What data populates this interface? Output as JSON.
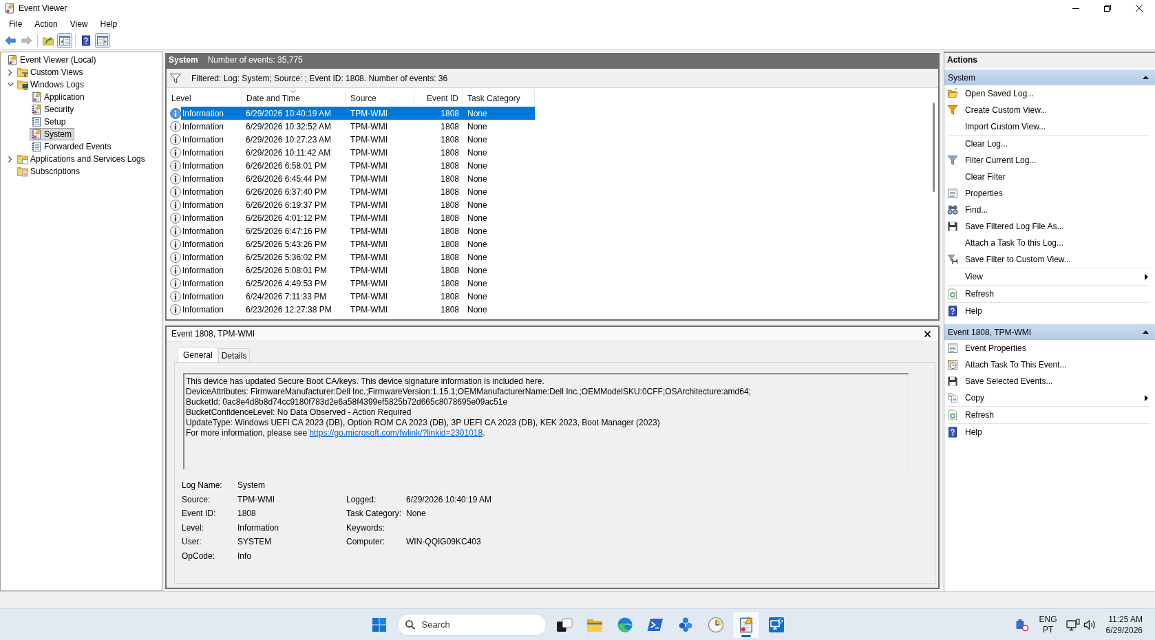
{
  "window": {
    "title": "Event Viewer"
  },
  "menu": [
    {
      "label": "File"
    },
    {
      "label": "Action"
    },
    {
      "label": "View"
    },
    {
      "label": "Help"
    }
  ],
  "toolbar": [
    [
      {
        "kind": "back",
        "disabled": false,
        "on": false
      },
      {
        "kind": "forward",
        "disabled": true,
        "on": false
      }
    ],
    [
      {
        "kind": "up",
        "disabled": false,
        "on": false
      },
      {
        "kind": "treepane",
        "disabled": false,
        "on": true
      }
    ],
    [
      {
        "kind": "help",
        "disabled": false,
        "on": false
      },
      {
        "kind": "actionpane",
        "disabled": false,
        "on": true
      }
    ]
  ],
  "tree": [
    {
      "label": "Event Viewer (Local)",
      "kind": "root",
      "selected": false,
      "children": [
        {
          "label": "Custom Views",
          "kind": "filterfolder",
          "expanded": false,
          "selected": false
        },
        {
          "label": "Windows Logs",
          "kind": "logfolder",
          "expanded": true,
          "selected": false,
          "children": [
            {
              "label": "Application",
              "kind": "alertlog",
              "selected": false
            },
            {
              "label": "Security",
              "kind": "alertlog",
              "selected": false
            },
            {
              "label": "Setup",
              "kind": "log",
              "selected": false
            },
            {
              "label": "System",
              "kind": "alertlog",
              "selected": true
            },
            {
              "label": "Forwarded Events",
              "kind": "log",
              "selected": false
            }
          ]
        },
        {
          "label": "Applications and Services Logs",
          "kind": "appfolder",
          "expanded": false,
          "selected": false
        },
        {
          "label": "Subscriptions",
          "kind": "subfolder",
          "selected": false
        }
      ]
    }
  ],
  "log_header": {
    "title": "System",
    "count": "Number of events: 35,775"
  },
  "filter": {
    "text": "Filtered: Log: System; Source: ; Event ID: 1808. Number of events: 36"
  },
  "table": {
    "columns": [
      {
        "label": "Level",
        "kind": "text",
        "sorted": false
      },
      {
        "label": "Date and Time",
        "kind": "text",
        "sorted": true
      },
      {
        "label": "Source",
        "kind": "text",
        "sorted": false
      },
      {
        "label": "Event ID",
        "kind": "number",
        "sorted": false
      },
      {
        "label": "Task Category",
        "kind": "text",
        "sorted": false
      }
    ],
    "rows": [
      {
        "cells": [
          "Information",
          "6/29/2026 10:40:19 AM",
          "TPM-WMI",
          "1808",
          "None"
        ],
        "selected": true
      },
      {
        "cells": [
          "Information",
          "6/29/2026 10:32:52 AM",
          "TPM-WMI",
          "1808",
          "None"
        ],
        "selected": false
      },
      {
        "cells": [
          "Information",
          "6/29/2026 10:27:23 AM",
          "TPM-WMI",
          "1808",
          "None"
        ],
        "selected": false
      },
      {
        "cells": [
          "Information",
          "6/29/2026 10:11:42 AM",
          "TPM-WMI",
          "1808",
          "None"
        ],
        "selected": false
      },
      {
        "cells": [
          "Information",
          "6/26/2026 6:58:01 PM",
          "TPM-WMI",
          "1808",
          "None"
        ],
        "selected": false
      },
      {
        "cells": [
          "Information",
          "6/26/2026 6:45:44 PM",
          "TPM-WMI",
          "1808",
          "None"
        ],
        "selected": false
      },
      {
        "cells": [
          "Information",
          "6/26/2026 6:37:40 PM",
          "TPM-WMI",
          "1808",
          "None"
        ],
        "selected": false
      },
      {
        "cells": [
          "Information",
          "6/26/2026 6:19:37 PM",
          "TPM-WMI",
          "1808",
          "None"
        ],
        "selected": false
      },
      {
        "cells": [
          "Information",
          "6/26/2026 4:01:12 PM",
          "TPM-WMI",
          "1808",
          "None"
        ],
        "selected": false
      },
      {
        "cells": [
          "Information",
          "6/25/2026 6:47:16 PM",
          "TPM-WMI",
          "1808",
          "None"
        ],
        "selected": false
      },
      {
        "cells": [
          "Information",
          "6/25/2026 5:43:26 PM",
          "TPM-WMI",
          "1808",
          "None"
        ],
        "selected": false
      },
      {
        "cells": [
          "Information",
          "6/25/2026 5:36:02 PM",
          "TPM-WMI",
          "1808",
          "None"
        ],
        "selected": false
      },
      {
        "cells": [
          "Information",
          "6/25/2026 5:08:01 PM",
          "TPM-WMI",
          "1808",
          "None"
        ],
        "selected": false
      },
      {
        "cells": [
          "Information",
          "6/25/2026 4:49:53 PM",
          "TPM-WMI",
          "1808",
          "None"
        ],
        "selected": false
      },
      {
        "cells": [
          "Information",
          "6/24/2026 7:11:33 PM",
          "TPM-WMI",
          "1808",
          "None"
        ],
        "selected": false
      },
      {
        "cells": [
          "Information",
          "6/23/2026 12:27:38 PM",
          "TPM-WMI",
          "1808",
          "None"
        ],
        "selected": false
      }
    ]
  },
  "event": {
    "title": "Event 1808, TPM-WMI",
    "tabs": [
      {
        "label": "General",
        "selected": true
      },
      {
        "label": "Details",
        "selected": false
      }
    ],
    "message": [
      "This device has updated Secure Boot CA/keys. This device signature information is included here.",
      "DeviceAttributes: FirmwareManufacturer:Dell Inc.;FirmwareVersion:1.15.1;OEMManufacturerName:Dell Inc.;OEMModelSKU:0CFF;OSArchitecture:amd64;",
      "BucketId: 0ac8e4d8b8d74cc9180f783d2e6a58f4399ef5825b72d665c8078695e09ac51e",
      "BucketConfidenceLevel: No Data Observed - Action Required",
      "UpdateType: Windows UEFI CA 2023 (DB), Option ROM CA 2023 (DB), 3P UEFI CA 2023 (DB), KEK 2023, Boot Manager (2023)"
    ],
    "more_info": {
      "text": "For more information, please see ",
      "link": "https://go.microsoft.com/fwlink/?linkid=2301018",
      "end": "."
    },
    "fields": [
      [
        {
          "label": "Log Name:",
          "value": "System"
        }
      ],
      [
        {
          "label": "Source:",
          "value": "TPM-WMI"
        },
        {
          "label": "Logged:",
          "value": "6/29/2026 10:40:19 AM"
        }
      ],
      [
        {
          "label": "Event ID:",
          "value": "1808"
        },
        {
          "label": "Task Category:",
          "value": "None"
        }
      ],
      [
        {
          "label": "Level:",
          "value": "Information"
        },
        {
          "label": "Keywords:"
        }
      ],
      [
        {
          "label": "User:",
          "value": "SYSTEM"
        },
        {
          "label": "Computer:",
          "value": "WIN-QQIG09KC403"
        }
      ],
      [
        {
          "label": "OpCode:",
          "value": "Info"
        }
      ]
    ]
  },
  "actions": {
    "title": "Actions",
    "sections": [
      {
        "title": "System",
        "expanded": true,
        "groups": [
          [
            {
              "label": "Open Saved Log...",
              "kind": "open",
              "submenu": false
            },
            {
              "label": "Create Custom View...",
              "kind": "newview",
              "submenu": false
            },
            {
              "label": "Import Custom View...",
              "kind": "plain",
              "submenu": false
            }
          ],
          [
            {
              "label": "Clear Log...",
              "kind": "plain",
              "submenu": false
            },
            {
              "label": "Filter Current Log...",
              "kind": "filter",
              "submenu": false
            },
            {
              "label": "Clear Filter",
              "kind": "plain",
              "submenu": false
            },
            {
              "label": "Properties",
              "kind": "properties",
              "submenu": false
            },
            {
              "label": "Find...",
              "kind": "find",
              "submenu": false
            },
            {
              "label": "Save Filtered Log File As...",
              "kind": "save",
              "submenu": false
            },
            {
              "label": "Attach a Task To this Log...",
              "kind": "plain",
              "submenu": false
            },
            {
              "label": "Save Filter to Custom View...",
              "kind": "savefilter",
              "submenu": false
            }
          ],
          [
            {
              "label": "View",
              "kind": "plain",
              "submenu": true
            }
          ],
          [
            {
              "label": "Refresh",
              "kind": "refresh",
              "submenu": false
            }
          ],
          [
            {
              "label": "Help",
              "kind": "help",
              "submenu": false
            }
          ]
        ]
      },
      {
        "title": "Event 1808, TPM-WMI",
        "expanded": true,
        "groups": [
          [
            {
              "label": "Event Properties",
              "kind": "properties",
              "submenu": false
            },
            {
              "label": "Attach Task To This Event...",
              "kind": "task",
              "submenu": false
            },
            {
              "label": "Save Selected Events...",
              "kind": "save",
              "submenu": false
            },
            {
              "label": "Copy",
              "kind": "copy",
              "submenu": true
            }
          ],
          [
            {
              "label": "Refresh",
              "kind": "refresh",
              "submenu": false
            }
          ],
          [
            {
              "label": "Help",
              "kind": "help",
              "submenu": false
            }
          ]
        ]
      }
    ]
  },
  "taskbar": {
    "search": {
      "placeholder": "Search"
    },
    "apps": [
      {
        "kind": "taskview",
        "active": false
      },
      {
        "kind": "explorer",
        "active": false
      },
      {
        "kind": "browser",
        "active": false
      },
      {
        "kind": "terminal",
        "active": false
      },
      {
        "kind": "cubes",
        "active": false
      },
      {
        "kind": "clock",
        "active": false
      },
      {
        "kind": "eventviewer",
        "active": true
      },
      {
        "kind": "remote",
        "active": false
      }
    ],
    "tray": {
      "language": "ENG",
      "layout": "PT",
      "time": "11:25 AM",
      "date": "6/29/2026"
    }
  }
}
